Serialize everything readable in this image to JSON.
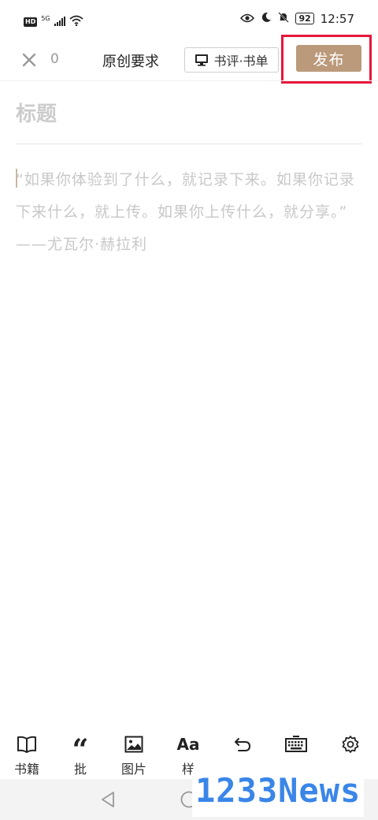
{
  "status_bar": {
    "hd": "HD",
    "network": "5G",
    "battery": "92",
    "time": "12:57"
  },
  "top_bar": {
    "word_count": "0",
    "originality_label": "原创要求",
    "review_label": "书评·书单",
    "publish_label": "发布"
  },
  "editor": {
    "title_placeholder": "标题",
    "content_placeholder": "“如果你体验到了什么，就记录下来。如果你记录下来什么，就上传。如果你上传什么，就分享。”",
    "content_author": "——尤瓦尔·赫拉利"
  },
  "toolbar": {
    "items": [
      {
        "label": "书籍",
        "icon": "book-icon"
      },
      {
        "label": "批",
        "icon": "quote-icon"
      },
      {
        "label": "图片",
        "icon": "image-icon"
      },
      {
        "label": "样",
        "icon": "text-style-icon"
      },
      {
        "label": "",
        "icon": "undo-icon"
      },
      {
        "label": "",
        "icon": "keyboard-icon"
      },
      {
        "label": "",
        "icon": "settings-icon"
      }
    ]
  },
  "watermark": "1233News",
  "colors": {
    "publish": "#bb9a7b",
    "highlight": "#e5173b",
    "placeholder": "#c8c8c8"
  }
}
